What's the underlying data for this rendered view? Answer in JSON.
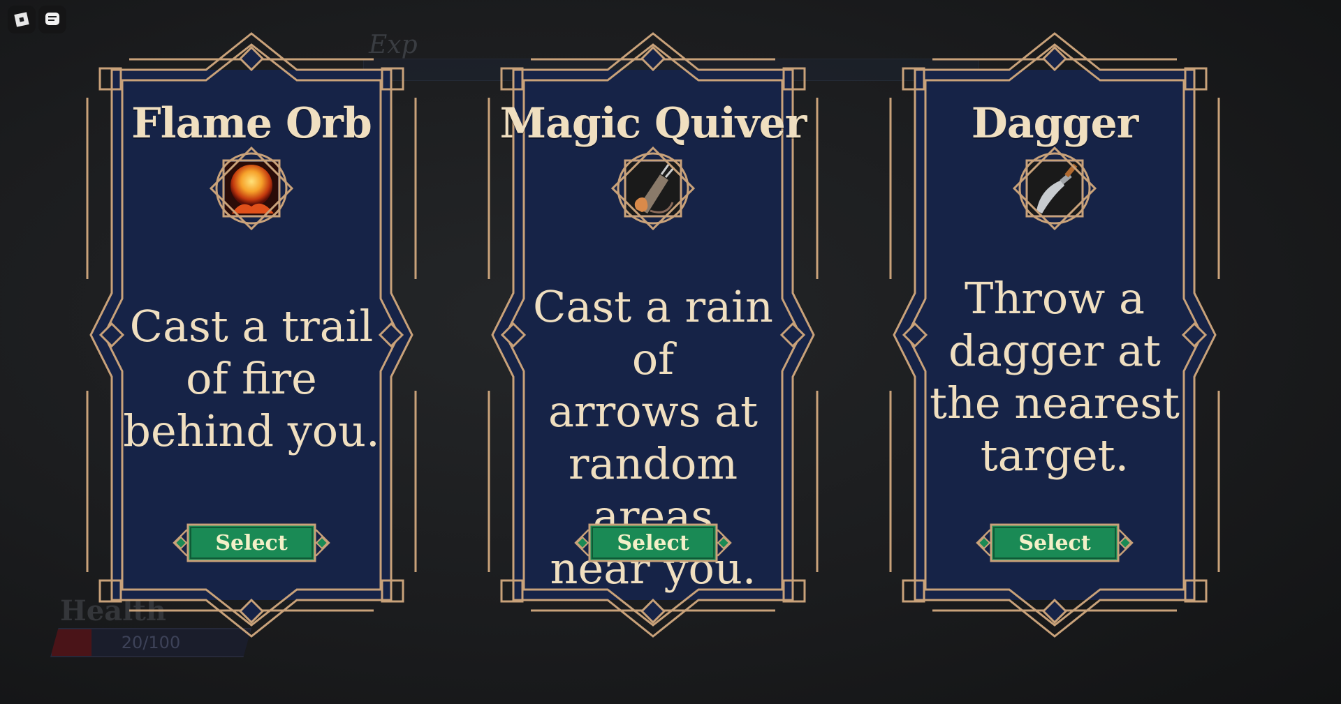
{
  "top_buttons": [
    {
      "icon": "roblox-menu-icon"
    },
    {
      "icon": "chat-icon"
    }
  ],
  "background_hud": {
    "exp_label": "Exp",
    "health_label": "Health",
    "health_value": "20/100",
    "health_fraction": 0.2
  },
  "colors": {
    "card_fill": "#162347",
    "frame_gold": "#c9a27a",
    "title_text": "#f0dfc0",
    "button_green": "#1a8a55"
  },
  "cards": [
    {
      "title": "Flame Orb",
      "icon": "flame-orb-icon",
      "description_lines": [
        "Cast a trail",
        "of fire",
        "behind you."
      ],
      "select_label": "Select"
    },
    {
      "title": "Magic Quiver",
      "icon": "magic-quiver-icon",
      "description_lines": [
        "Cast a rain of",
        "arrows at",
        "random areas",
        "near you."
      ],
      "select_label": "Select"
    },
    {
      "title": "Dagger",
      "icon": "dagger-icon",
      "description_lines": [
        "Throw a",
        "dagger at",
        "the nearest",
        "target."
      ],
      "select_label": "Select"
    }
  ]
}
